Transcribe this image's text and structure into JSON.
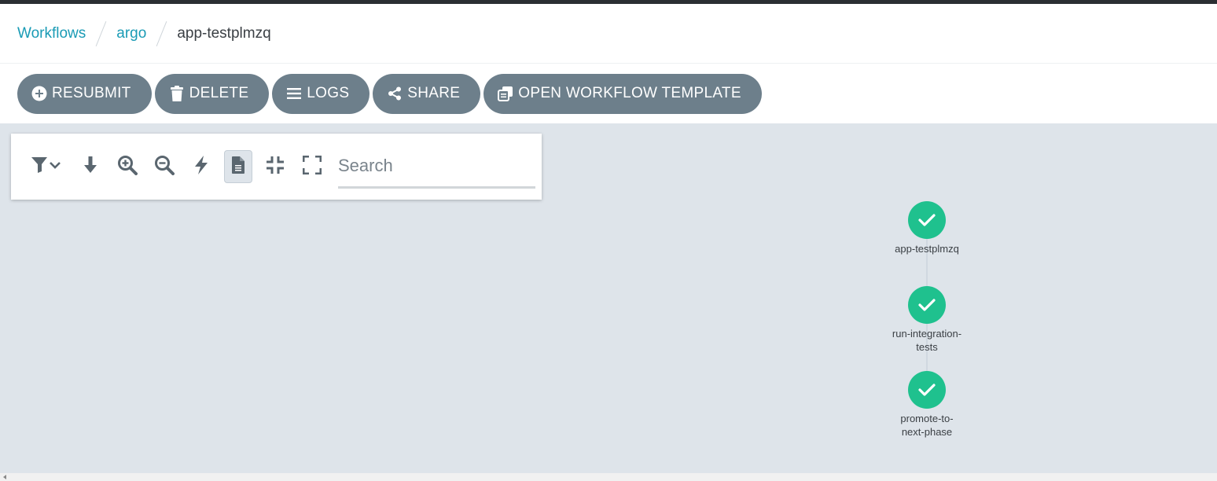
{
  "breadcrumbs": {
    "workflows": "Workflows",
    "namespace": "argo",
    "current": "app-testplmzq"
  },
  "actions": {
    "resubmit": "RESUBMIT",
    "delete": "DELETE",
    "logs": "LOGS",
    "share": "SHARE",
    "open_template": "OPEN WORKFLOW TEMPLATE"
  },
  "toolbar": {
    "icons": [
      "filter-icon",
      "download-icon",
      "zoom-in-icon",
      "zoom-out-icon",
      "lightning-icon",
      "document-icon",
      "collapse-icon",
      "fullscreen-icon"
    ],
    "search_placeholder": "Search",
    "active_tool": "document-icon"
  },
  "graph": {
    "nodes": [
      {
        "name": "app-testplmzq",
        "label_lines": [
          "app-testplmzq"
        ],
        "status": "succeeded"
      },
      {
        "name": "run-integration-tests",
        "label_lines": [
          "run-integration-",
          "tests"
        ],
        "status": "succeeded"
      },
      {
        "name": "promote-to-next-phase",
        "label_lines": [
          "promote-to-",
          "next-phase"
        ],
        "status": "succeeded"
      }
    ],
    "status_color": "#1fc18e"
  }
}
